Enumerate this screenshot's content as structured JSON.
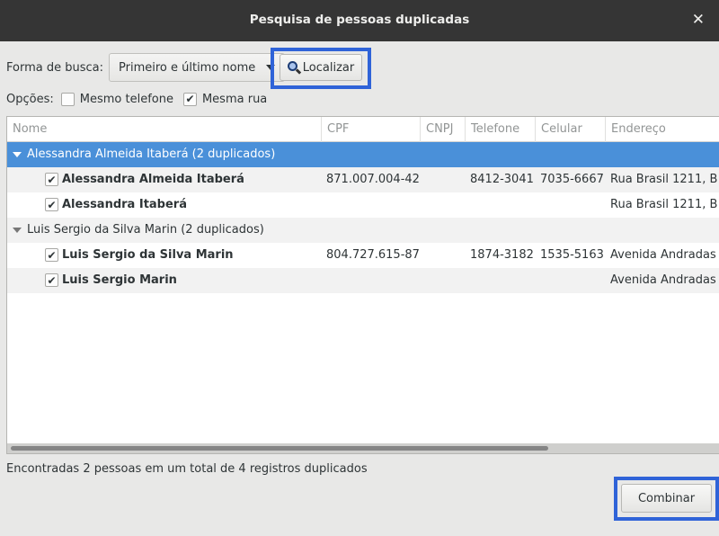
{
  "window": {
    "title": "Pesquisa de pessoas duplicadas",
    "close_icon": "✕"
  },
  "search": {
    "label": "Forma de busca:",
    "selected_option": "Primeiro e último nome",
    "find_button": "Localizar"
  },
  "options": {
    "label": "Opções:",
    "same_phone": {
      "label": "Mesmo telefone",
      "checked": false
    },
    "same_street": {
      "label": "Mesma rua",
      "checked": true
    }
  },
  "table": {
    "columns": [
      "Nome",
      "CPF",
      "CNPJ",
      "Telefone",
      "Celular",
      "Endereço"
    ],
    "groups": [
      {
        "title": "Alessandra Almeida Itaberá (2 duplicados)",
        "expanded": true,
        "selected": true,
        "rows": [
          {
            "checked": true,
            "name": "Alessandra Almeida Itaberá",
            "cpf": "871.007.004-42",
            "cnpj": "",
            "phone": "8412-3041",
            "mobile": "7035-6667",
            "address": "Rua Brasil 1211, B"
          },
          {
            "checked": true,
            "name": "Alessandra Itaberá",
            "cpf": "",
            "cnpj": "",
            "phone": "",
            "mobile": "",
            "address": "Rua Brasil 1211, B"
          }
        ]
      },
      {
        "title": "Luis Sergio da Silva Marin (2 duplicados)",
        "expanded": true,
        "selected": false,
        "rows": [
          {
            "checked": true,
            "name": "Luis Sergio da Silva Marin",
            "cpf": "804.727.615-87",
            "cnpj": "",
            "phone": "1874-3182",
            "mobile": "1535-5163",
            "address": "Avenida Andradas"
          },
          {
            "checked": true,
            "name": "Luis Sergio Marin",
            "cpf": "",
            "cnpj": "",
            "phone": "",
            "mobile": "",
            "address": "Avenida Andradas"
          }
        ]
      }
    ]
  },
  "status": "Encontradas 2 pessoas em um total de 4 registros duplicados",
  "merge_button": "Combinar",
  "colors": {
    "highlight_box": "#2f63d8",
    "selection": "#4a90d9",
    "titlebar": "#353535"
  }
}
